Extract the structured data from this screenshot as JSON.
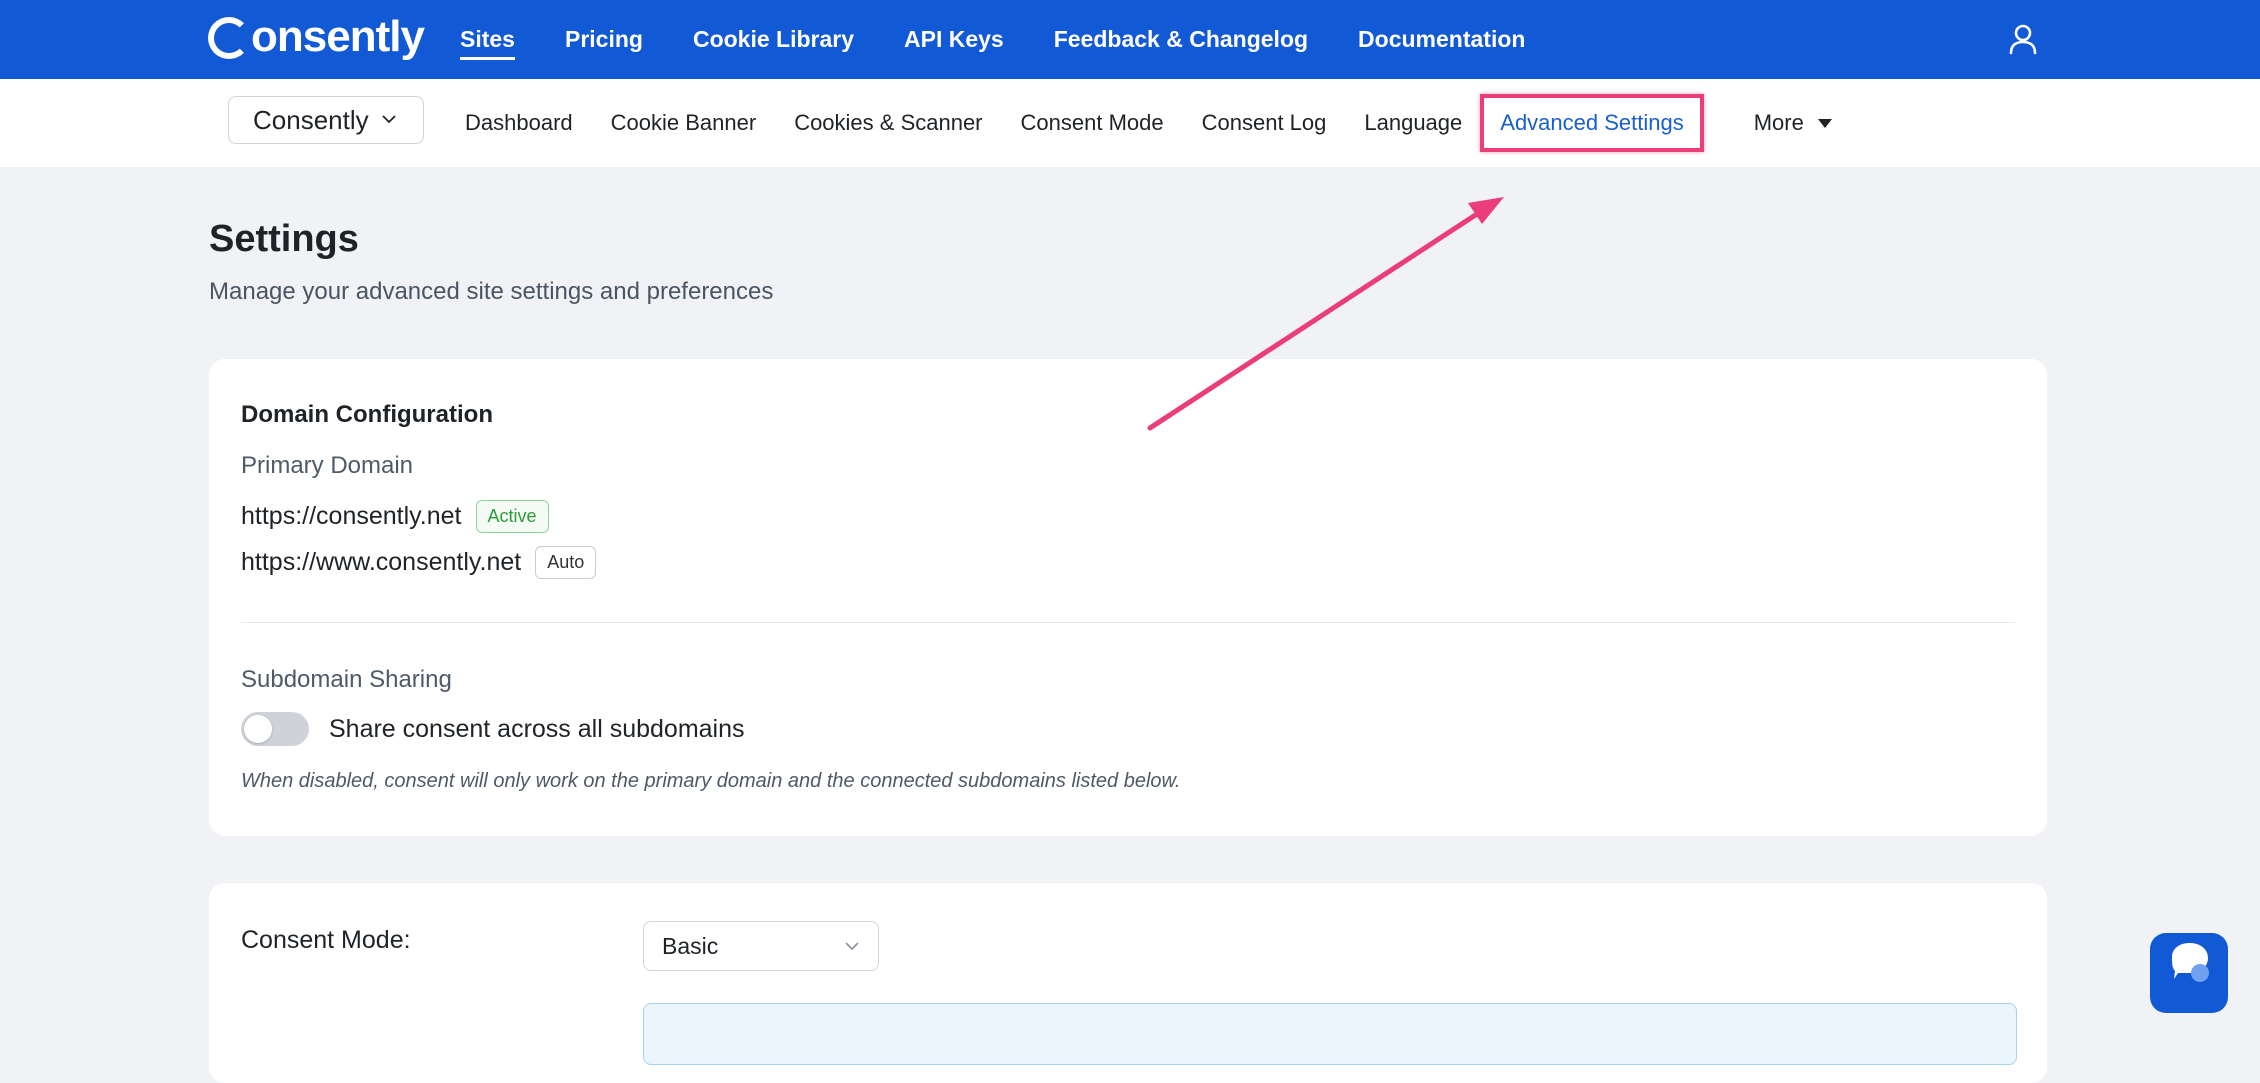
{
  "topbar": {
    "logo": "onsently",
    "nav": [
      {
        "label": "Sites",
        "active": true
      },
      {
        "label": "Pricing"
      },
      {
        "label": "Cookie Library"
      },
      {
        "label": "API Keys"
      },
      {
        "label": "Feedback & Changelog"
      },
      {
        "label": "Documentation"
      }
    ],
    "user_icon": "user-icon"
  },
  "subnav": {
    "site_selector": "Consently",
    "tabs": [
      {
        "label": "Dashboard"
      },
      {
        "label": "Cookie Banner"
      },
      {
        "label": "Cookies & Scanner"
      },
      {
        "label": "Consent Mode"
      },
      {
        "label": "Consent Log"
      },
      {
        "label": "Language"
      },
      {
        "label": "Advanced Settings",
        "highlighted": true
      },
      {
        "label": "More"
      }
    ]
  },
  "page": {
    "title": "Settings",
    "subtitle": "Manage your advanced site settings and preferences"
  },
  "domain_config": {
    "title": "Domain Configuration",
    "primary_label": "Primary Domain",
    "domains": [
      {
        "url": "https://consently.net",
        "badge": "Active"
      },
      {
        "url": "https://www.consently.net",
        "badge": "Auto"
      }
    ],
    "subdomain_label": "Subdomain Sharing",
    "toggle_label": "Share consent across all subdomains",
    "toggle_on": false,
    "help": "When disabled, consent will only work on the primary domain and the connected subdomains listed below."
  },
  "consent_mode": {
    "label": "Consent Mode:",
    "value": "Basic"
  },
  "colors": {
    "brand": "#1259d6",
    "highlight": "#ea3d7a",
    "link": "#1a5fd0"
  }
}
